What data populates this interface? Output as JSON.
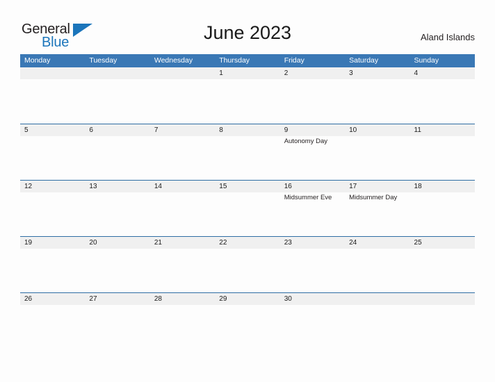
{
  "brand": {
    "name_part1": "General",
    "name_part2": "Blue",
    "triangle_icon": "blue-triangle-icon",
    "accent_color": "#1b75bb"
  },
  "header": {
    "title": "June 2023",
    "region": "Aland Islands"
  },
  "calendar": {
    "header_bg_color": "#3a78b5",
    "band_color": "#f0f0f0",
    "row_border_color": "#2e6da4",
    "weekdays": [
      "Monday",
      "Tuesday",
      "Wednesday",
      "Thursday",
      "Friday",
      "Saturday",
      "Sunday"
    ],
    "weeks": [
      [
        {
          "date": "",
          "events": []
        },
        {
          "date": "",
          "events": []
        },
        {
          "date": "",
          "events": []
        },
        {
          "date": "1",
          "events": []
        },
        {
          "date": "2",
          "events": []
        },
        {
          "date": "3",
          "events": []
        },
        {
          "date": "4",
          "events": []
        }
      ],
      [
        {
          "date": "5",
          "events": []
        },
        {
          "date": "6",
          "events": []
        },
        {
          "date": "7",
          "events": []
        },
        {
          "date": "8",
          "events": []
        },
        {
          "date": "9",
          "events": [
            "Autonomy Day"
          ]
        },
        {
          "date": "10",
          "events": []
        },
        {
          "date": "11",
          "events": []
        }
      ],
      [
        {
          "date": "12",
          "events": []
        },
        {
          "date": "13",
          "events": []
        },
        {
          "date": "14",
          "events": []
        },
        {
          "date": "15",
          "events": []
        },
        {
          "date": "16",
          "events": [
            "Midsummer Eve"
          ]
        },
        {
          "date": "17",
          "events": [
            "Midsummer Day"
          ]
        },
        {
          "date": "18",
          "events": []
        }
      ],
      [
        {
          "date": "19",
          "events": []
        },
        {
          "date": "20",
          "events": []
        },
        {
          "date": "21",
          "events": []
        },
        {
          "date": "22",
          "events": []
        },
        {
          "date": "23",
          "events": []
        },
        {
          "date": "24",
          "events": []
        },
        {
          "date": "25",
          "events": []
        }
      ],
      [
        {
          "date": "26",
          "events": []
        },
        {
          "date": "27",
          "events": []
        },
        {
          "date": "28",
          "events": []
        },
        {
          "date": "29",
          "events": []
        },
        {
          "date": "30",
          "events": []
        },
        {
          "date": "",
          "events": []
        },
        {
          "date": "",
          "events": []
        }
      ]
    ]
  }
}
